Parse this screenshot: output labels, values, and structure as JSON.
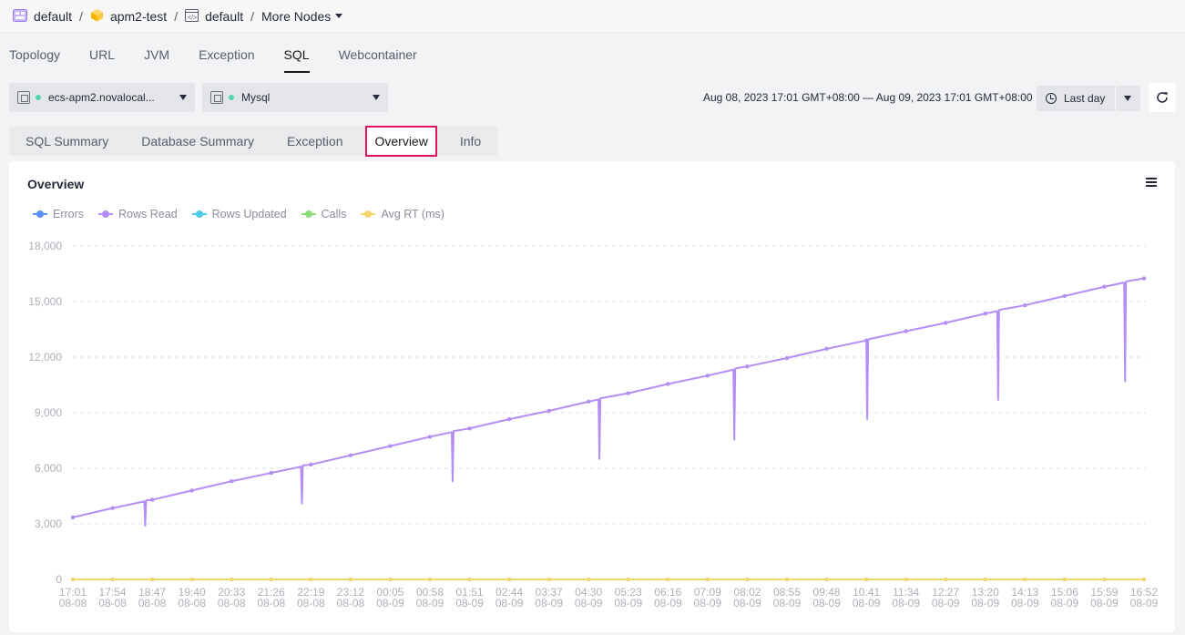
{
  "breadcrumb": {
    "items": [
      "default",
      "apm2-test",
      "default",
      "More Nodes"
    ]
  },
  "main_tabs": [
    "Topology",
    "URL",
    "JVM",
    "Exception",
    "SQL",
    "Webcontainer"
  ],
  "active_main_tab": "SQL",
  "instance_select": {
    "value": "ecs-apm2.novalocal..."
  },
  "db_select": {
    "value": "Mysql"
  },
  "time_range": "Aug 08, 2023 17:01 GMT+08:00 — Aug 09, 2023 17:01 GMT+08:00",
  "period": "Last day",
  "sub_tabs": [
    "SQL Summary",
    "Database Summary",
    "Exception",
    "Overview",
    "Info"
  ],
  "active_sub_tab": "Overview",
  "card_title": "Overview",
  "colors": {
    "errors": "#5b8ff9",
    "rows_read": "#b48ef5",
    "rows_updated": "#4fc9e8",
    "calls": "#8bdc7a",
    "avg_rt": "#f5d66b"
  },
  "chart_data": {
    "type": "line",
    "title": "Overview",
    "xlabel": "",
    "ylabel": "",
    "ylim": [
      0,
      18000
    ],
    "yticks": [
      "18,000",
      "15,000",
      "12,000",
      "9,000",
      "6,000",
      "3,000",
      "0"
    ],
    "x_time": [
      "17:01",
      "17:54",
      "18:47",
      "19:40",
      "20:33",
      "21:26",
      "22:19",
      "23:12",
      "00:05",
      "00:58",
      "01:51",
      "02:44",
      "03:37",
      "04:30",
      "05:23",
      "06:16",
      "07:09",
      "08:02",
      "08:55",
      "09:48",
      "10:41",
      "11:34",
      "12:27",
      "13:20",
      "14:13",
      "15:06",
      "15:59",
      "16:52"
    ],
    "x_date": [
      "08-08",
      "08-08",
      "08-08",
      "08-08",
      "08-08",
      "08-08",
      "08-08",
      "08-08",
      "08-09",
      "08-09",
      "08-09",
      "08-09",
      "08-09",
      "08-09",
      "08-09",
      "08-09",
      "08-09",
      "08-09",
      "08-09",
      "08-09",
      "08-09",
      "08-09",
      "08-09",
      "08-09",
      "08-09",
      "08-09",
      "08-09",
      "08-09"
    ],
    "grid": true,
    "legend_position": "top-left",
    "series": [
      {
        "name": "Errors",
        "values": [
          0,
          0,
          0,
          0,
          0,
          0,
          0,
          0,
          0,
          0,
          0,
          0,
          0,
          0,
          0,
          0,
          0,
          0,
          0,
          0,
          0,
          0,
          0,
          0,
          0,
          0,
          0,
          0
        ]
      },
      {
        "name": "Rows Read",
        "values": [
          3350,
          3850,
          4300,
          4800,
          5300,
          5750,
          6200,
          6700,
          7200,
          7700,
          8150,
          8650,
          9100,
          9600,
          10050,
          10550,
          11000,
          11500,
          11950,
          12450,
          12900,
          13400,
          13850,
          14350,
          14800,
          15300,
          15800,
          16250
        ],
        "dips": [
          {
            "at": 1.8,
            "value": 2900
          },
          {
            "at": 5.75,
            "value": 4100
          },
          {
            "at": 9.55,
            "value": 5300
          },
          {
            "at": 13.25,
            "value": 6500
          },
          {
            "at": 16.65,
            "value": 7550
          },
          {
            "at": 20.0,
            "value": 8650
          },
          {
            "at": 23.3,
            "value": 9700
          },
          {
            "at": 26.5,
            "value": 10700
          }
        ]
      },
      {
        "name": "Rows Updated",
        "values": [
          0,
          0,
          0,
          0,
          0,
          0,
          0,
          0,
          0,
          0,
          0,
          0,
          0,
          0,
          0,
          0,
          0,
          0,
          0,
          0,
          0,
          0,
          0,
          0,
          0,
          0,
          0,
          0
        ]
      },
      {
        "name": "Calls",
        "values": [
          0,
          0,
          0,
          0,
          0,
          0,
          0,
          0,
          0,
          0,
          0,
          0,
          0,
          0,
          0,
          0,
          0,
          0,
          0,
          0,
          0,
          0,
          0,
          0,
          0,
          0,
          0,
          0
        ]
      },
      {
        "name": "Avg RT (ms)",
        "values": [
          0,
          0,
          0,
          0,
          0,
          0,
          0,
          0,
          0,
          0,
          0,
          0,
          0,
          0,
          0,
          0,
          0,
          0,
          0,
          0,
          0,
          0,
          0,
          0,
          0,
          0,
          0,
          0
        ]
      }
    ]
  }
}
